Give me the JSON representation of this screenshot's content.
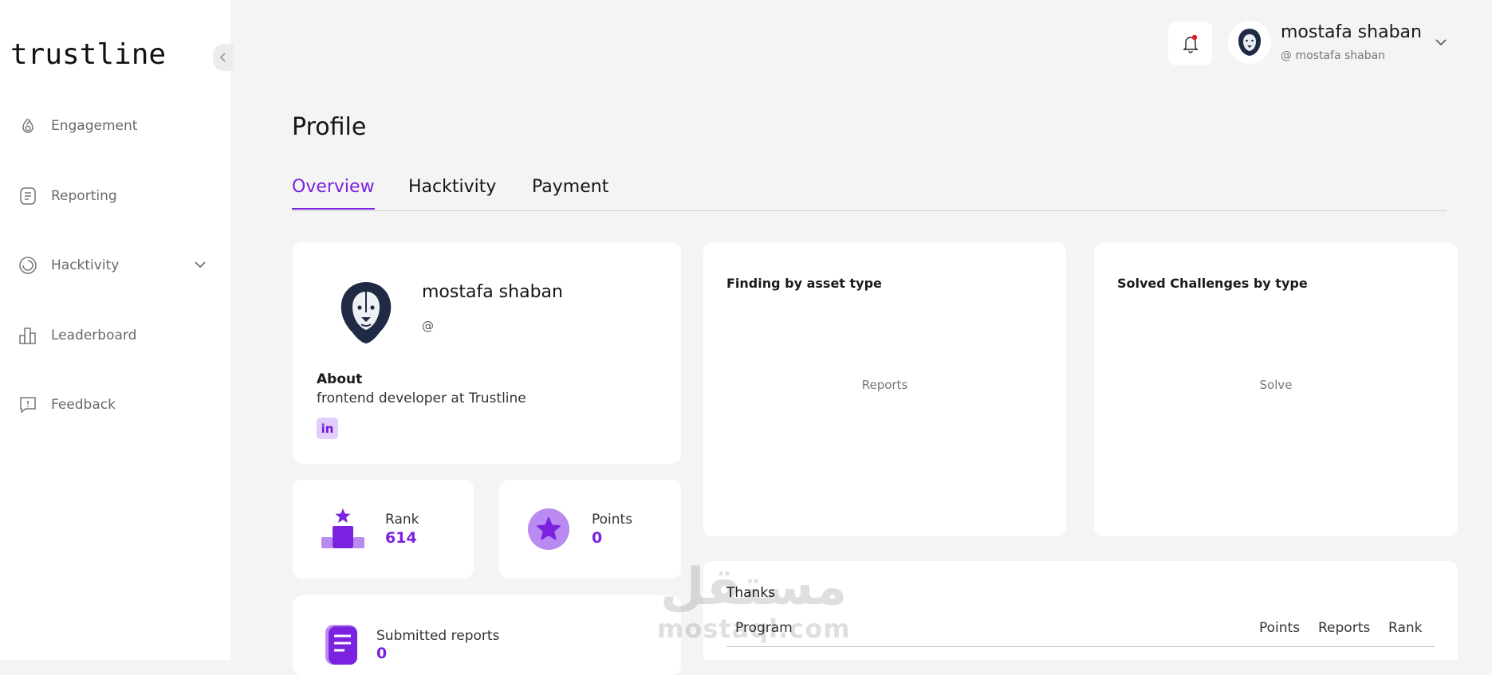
{
  "sidebar": {
    "logo": "trustline",
    "items": [
      {
        "label": "Engagement"
      },
      {
        "label": "Reporting"
      },
      {
        "label": "Hacktivity"
      },
      {
        "label": "Leaderboard"
      },
      {
        "label": "Feedback"
      }
    ]
  },
  "header": {
    "user_name": "mostafa shaban",
    "user_handle": "@ mostafa shaban"
  },
  "page": {
    "title": "Profile",
    "tabs": [
      {
        "label": "Overview",
        "active": true
      },
      {
        "label": "Hacktivity",
        "active": false
      },
      {
        "label": "Payment",
        "active": false
      }
    ]
  },
  "profile": {
    "name": "mostafa shaban",
    "handle": "@",
    "about_label": "About",
    "about_text": "frontend developer at Trustline",
    "linkedin_label": "in"
  },
  "stats": {
    "rank_label": "Rank",
    "rank_value": "614",
    "points_label": "Points",
    "points_value": "0",
    "submitted_label": "Submitted reports",
    "submitted_value": "0"
  },
  "findings": {
    "title": "Finding by asset type",
    "empty": "Reports"
  },
  "challenges": {
    "title": "Solved Challenges by type",
    "empty": "Solve"
  },
  "thanks": {
    "title": "Thanks",
    "columns": [
      "Program",
      "Points",
      "Reports",
      "Rank"
    ]
  },
  "watermark": {
    "arabic": "مستقل",
    "latin": "mostaql.com"
  },
  "colors": {
    "accent": "#7b22e0",
    "accent_light": "#b98af0",
    "background": "#f4f4f4",
    "notification_dot": "#e5172f"
  }
}
